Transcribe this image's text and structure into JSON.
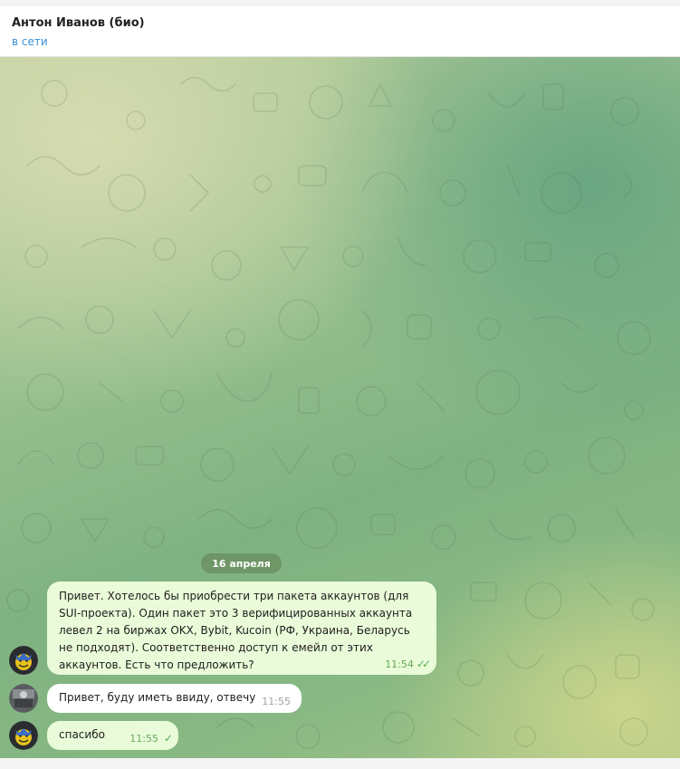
{
  "header": {
    "contact_name": "Антон Иванов (био)",
    "status": "в сети"
  },
  "chat": {
    "date_separator": "16 апреля",
    "messages": [
      {
        "direction": "outgoing",
        "text": "Привет. Хотелось бы приобрести три пакета аккаунтов (для SUI-проекта). Один пакет это 3 верифицированных аккаунта левел 2 на биржах OKX, Bybit, Kucoin (РФ, Украина, Беларусь не подходят). Соответственно доступ к емейл от этих аккаунтов. Есть что предложить?",
        "time": "11:54",
        "status_icon": "double-check-icon"
      },
      {
        "direction": "incoming",
        "text": "Привет, буду иметь ввиду, отвечу",
        "time": "11:55"
      },
      {
        "direction": "outgoing",
        "text": "спасибо",
        "time": "11:55",
        "status_icon": "single-check-icon"
      }
    ]
  },
  "colors": {
    "accent": "#3a8fd6",
    "outgoing_bubble": "#e9fbd8",
    "incoming_bubble": "#ffffff",
    "check": "#5fab58"
  }
}
